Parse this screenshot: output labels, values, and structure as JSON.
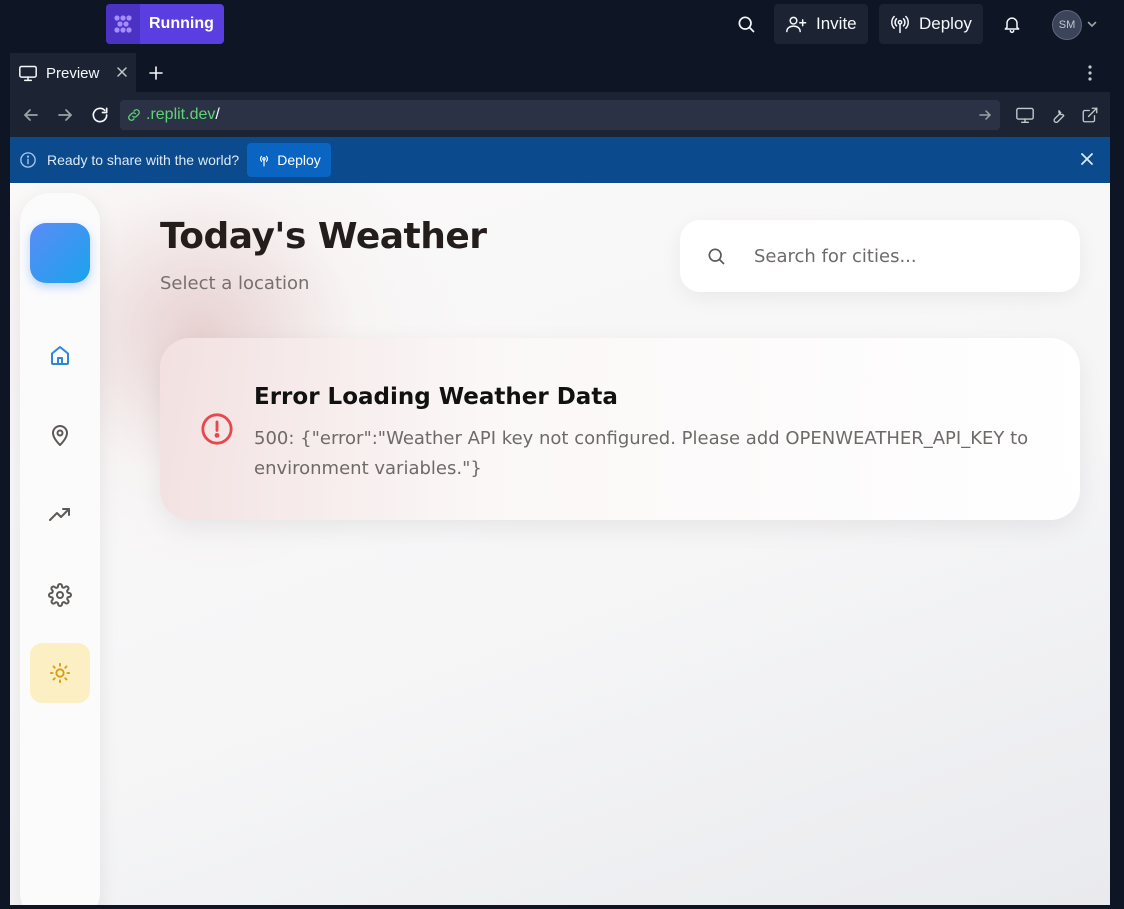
{
  "topbar": {
    "run_label": "Running",
    "invite_label": "Invite",
    "deploy_label": "Deploy",
    "avatar_initials": "SM"
  },
  "tabs": [
    {
      "label": "Preview",
      "active": true
    }
  ],
  "urlbar": {
    "url": ".replit.dev",
    "url_suffix": "/"
  },
  "banner": {
    "text": "Ready to share with the world?",
    "deploy_label": "Deploy"
  },
  "app": {
    "title": "Today's Weather",
    "subtitle": "Select a location",
    "search_placeholder": "Search for cities...",
    "error_title": "Error Loading Weather Data",
    "error_message": "500: {\"error\":\"Weather API key not configured. Please add OPENWEATHER_API_KEY to environment variables.\"}",
    "nav": [
      "home-icon",
      "map-pin-icon",
      "trending-up-icon",
      "settings-icon"
    ],
    "theme_icon": "sun-icon"
  },
  "colors": {
    "run_accent": "#5a3ee0",
    "banner_bg": "#0b4a8c",
    "error_red": "#e5484d",
    "brand_gradient": [
      "#5b8bf7",
      "#1aa3ec"
    ],
    "theme_toggle_bg": "#fcefc4",
    "sun": "#d99a0b",
    "url_green": "#5fd378"
  }
}
